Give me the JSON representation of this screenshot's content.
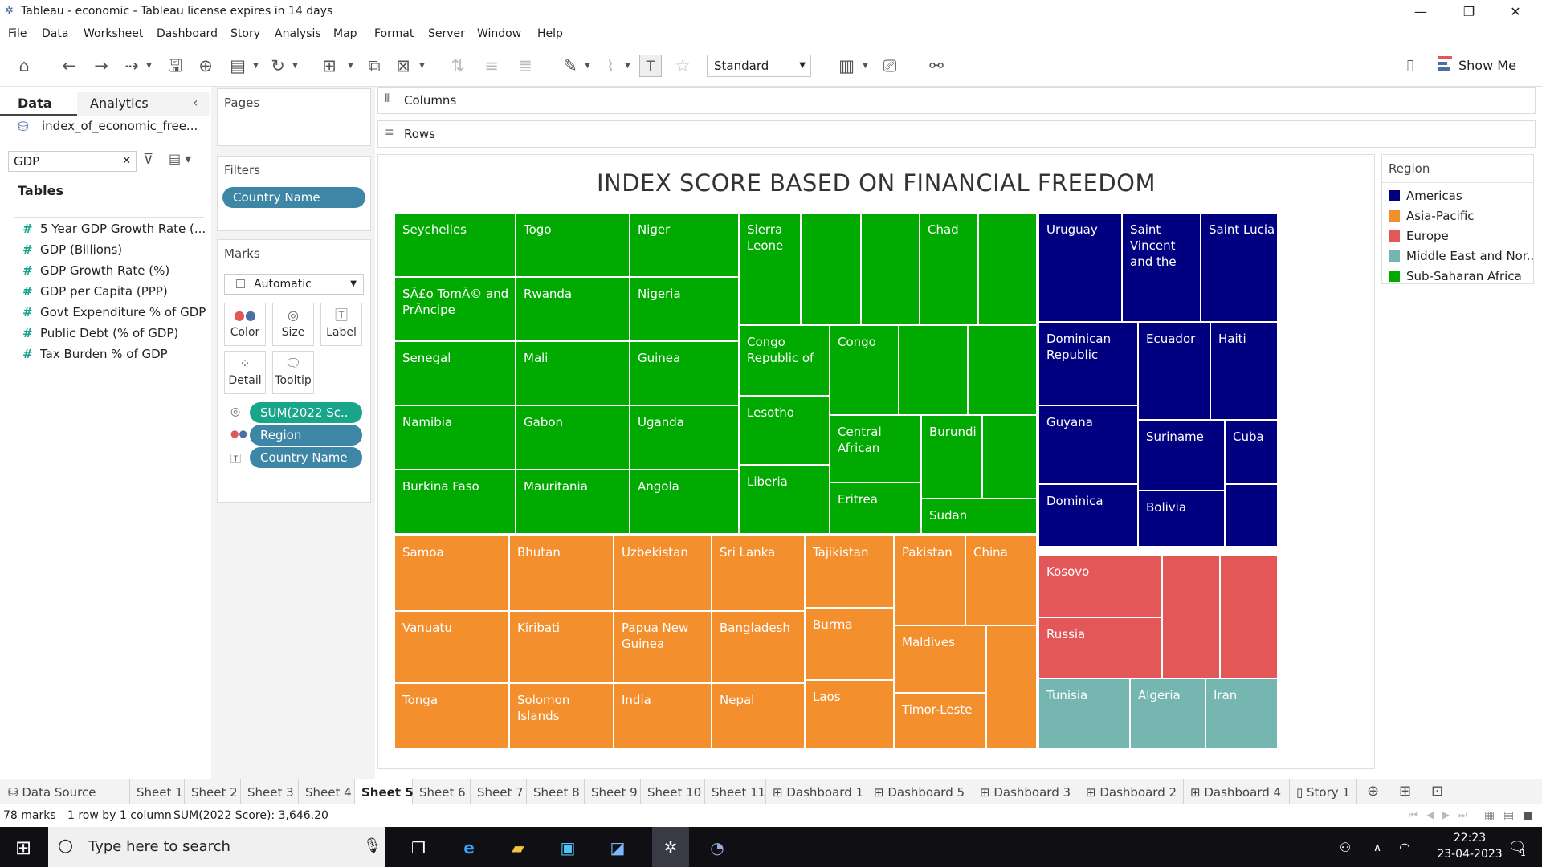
{
  "window": {
    "title": "Tableau - economic - Tableau license expires in 14 days"
  },
  "menu": [
    "File",
    "Data",
    "Worksheet",
    "Dashboard",
    "Story",
    "Analysis",
    "Map",
    "Format",
    "Server",
    "Window",
    "Help"
  ],
  "toolbar": {
    "fit_mode": "Standard",
    "show_me": "Show Me"
  },
  "data_pane": {
    "tabs": [
      "Data",
      "Analytics"
    ],
    "datasource": "index_of_economic_free...",
    "search_value": "GDP",
    "tables_heading": "Tables",
    "fields": [
      "5 Year GDP Growth Rate (...",
      "GDP (Billions)",
      "GDP Growth Rate (%)",
      "GDP per Capita (PPP)",
      "Govt Expenditure % of GDP",
      "Public Debt (% of GDP)",
      "Tax Burden % of GDP"
    ]
  },
  "pages_label": "Pages",
  "filters": {
    "label": "Filters",
    "pill": "Country Name"
  },
  "marks": {
    "label": "Marks",
    "type": "Automatic",
    "buttons": [
      "Color",
      "Size",
      "Label",
      "Detail",
      "Tooltip"
    ],
    "pills": [
      "SUM(2022 Sc..",
      "Region",
      "Country Name"
    ]
  },
  "shelves": {
    "columns": "Columns",
    "rows": "Rows"
  },
  "chart": {
    "title": "INDEX SCORE BASED ON FINANCIAL FREEDOM"
  },
  "chart_data": {
    "type": "treemap",
    "title": "INDEX SCORE BASED ON FINANCIAL FREEDOM",
    "size_measure": "SUM(2022 Score)",
    "color_dimension": "Region",
    "regions": [
      {
        "name": "Sub-Saharan Africa",
        "color": "#00aa00",
        "labeled_countries": [
          "Seychelles",
          "Togo",
          "Niger",
          "Sierra Leone",
          "Chad",
          "SÃ£o TomÃ© and PrÃ­ncipe",
          "Rwanda",
          "Nigeria",
          "Congo Republic of",
          "Congo",
          "Senegal",
          "Mali",
          "Guinea",
          "Lesotho",
          "Namibia",
          "Gabon",
          "Uganda",
          "Central African",
          "Burundi",
          "Burkina Faso",
          "Mauritania",
          "Angola",
          "Liberia",
          "Eritrea",
          "Sudan"
        ]
      },
      {
        "name": "Asia-Pacific",
        "color": "#f38f2d",
        "labeled_countries": [
          "Samoa",
          "Bhutan",
          "Uzbekistan",
          "Sri Lanka",
          "Tajikistan",
          "Pakistan",
          "China",
          "Vanuatu",
          "Kiribati",
          "Papua New Guinea",
          "Bangladesh",
          "Burma",
          "Maldives",
          "Tonga",
          "Solomon Islands",
          "India",
          "Nepal",
          "Laos",
          "Timor-Leste"
        ]
      },
      {
        "name": "Americas",
        "color": "#000080",
        "labeled_countries": [
          "Uruguay",
          "Saint Vincent and the",
          "Saint Lucia",
          "Dominican Republic",
          "Ecuador",
          "Haiti",
          "Guyana",
          "Suriname",
          "Cuba",
          "Dominica",
          "Bolivia"
        ]
      },
      {
        "name": "Europe",
        "color": "#e35759",
        "labeled_countries": [
          "Kosovo",
          "Russia"
        ]
      },
      {
        "name": "Middle East and Nor..",
        "color": "#76b6b1",
        "labeled_countries": [
          "Tunisia",
          "Algeria",
          "Iran"
        ]
      }
    ]
  },
  "legend": {
    "title": "Region",
    "items": [
      {
        "label": "Americas",
        "color": "#000080"
      },
      {
        "label": "Asia-Pacific",
        "color": "#f38f2d"
      },
      {
        "label": "Europe",
        "color": "#e35759"
      },
      {
        "label": "Middle East and Nor..",
        "color": "#76b6b1"
      },
      {
        "label": "Sub-Saharan Africa",
        "color": "#00aa00"
      }
    ]
  },
  "sheet_tabs": [
    "Data Source",
    "Sheet 1",
    "Sheet 2",
    "Sheet 3",
    "Sheet 4",
    "Sheet 5",
    "Sheet 6",
    "Sheet 7",
    "Sheet 8",
    "Sheet 9",
    "Sheet 10",
    "Sheet 11",
    "Dashboard 1",
    "Dashboard 5",
    "Dashboard 3",
    "Dashboard 2",
    "Dashboard 4",
    "Story 1"
  ],
  "active_tab": "Sheet 5",
  "status": {
    "marks": "78 marks",
    "rows": "1 row by 1 column",
    "sum": "SUM(2022 Score): 3,646.20"
  },
  "taskbar": {
    "search_placeholder": "Type here to search",
    "time": "22:23",
    "date": "23-04-2023",
    "notif_count": "1"
  }
}
